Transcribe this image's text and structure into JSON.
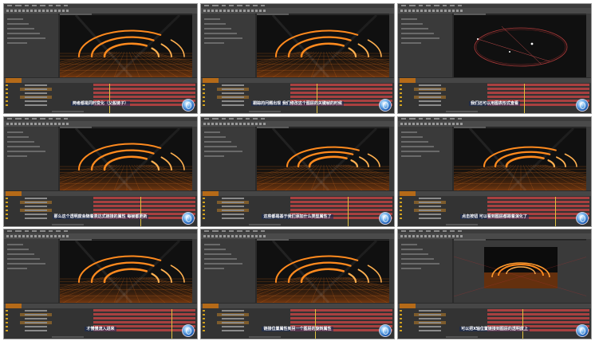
{
  "tiles": [
    {
      "subtitle": "两者都是同时变化（父般链子）",
      "variant": "rings"
    },
    {
      "subtitle": "跟踪的问题出现 我们修改这个图层的关键帧的时候",
      "variant": "rings"
    },
    {
      "subtitle": "我们还可以用图表形式查看",
      "variant": "ellipse"
    },
    {
      "subtitle": "那么这个透明度会随着表达式链接的属性 每帧都更新",
      "variant": "rings"
    },
    {
      "subtitle": "这些都是基于我们添加什么类型属性了",
      "variant": "rings-small"
    },
    {
      "subtitle": "点击按钮 可以看到图层都跟着演化了",
      "variant": "rings-small"
    },
    {
      "subtitle": "才慢慢流入进来",
      "variant": "rings"
    },
    {
      "subtitle": "链接位置属性到另一个图层的旋转属性",
      "variant": "rings"
    },
    {
      "subtitle": "可以把X轴位置链接到图层的透明度上",
      "variant": "preview"
    }
  ],
  "colors": {
    "accent": "#e07818",
    "ui_bg": "#2b2b2b",
    "timeline_bar": "#a84040"
  },
  "logo_icon": "globe-logo-icon"
}
